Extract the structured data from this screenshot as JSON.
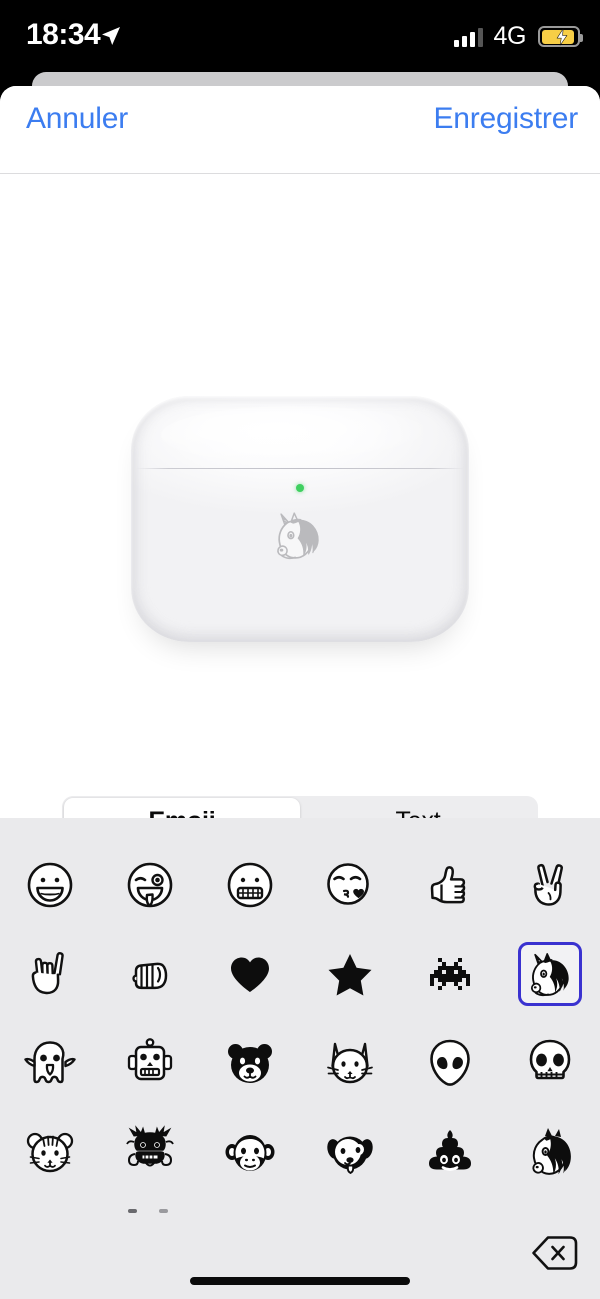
{
  "status_bar": {
    "time": "18:34",
    "location_icon": "location-arrow-icon",
    "signal_icon": "cellular-signal-icon",
    "signal_bars_filled": 3,
    "signal_bars_total": 4,
    "carrier_network": "4G",
    "battery_icon": "battery-charging-icon",
    "battery_color": "#F7CE46",
    "battery_level_percent": 76
  },
  "nav_bar": {
    "cancel_label": "Annuler",
    "save_label": "Enregistrer",
    "accent_color": "#3C7DF0"
  },
  "preview": {
    "device_name": "airpods-pro-case",
    "led_color": "#3FD060",
    "engraving_emoji": "unicorn",
    "engraving_glyph": "🦄"
  },
  "segmented_control": {
    "selected_index": 0,
    "options": [
      {
        "label": "Emoji",
        "selected": true
      },
      {
        "label": "Text",
        "selected": false
      }
    ]
  },
  "emoji_keyboard": {
    "background_color": "#EAEAEC",
    "selection_color": "#3A32D0",
    "selected_emoji": "unicorn",
    "delete_key_icon": "backspace-delete-icon",
    "page_count": 2,
    "current_page": 1,
    "rows": [
      [
        {
          "name": "grinning-face",
          "glyph": "😀"
        },
        {
          "name": "winking-face-with-tongue",
          "glyph": "😜"
        },
        {
          "name": "grimacing-face",
          "glyph": "😬"
        },
        {
          "name": "face-blowing-a-kiss",
          "glyph": "😘"
        },
        {
          "name": "thumbs-up",
          "glyph": "👍"
        },
        {
          "name": "victory-hand",
          "glyph": "✌"
        }
      ],
      [
        {
          "name": "love-you-gesture",
          "glyph": "🤟"
        },
        {
          "name": "oncoming-fist",
          "glyph": "👊"
        },
        {
          "name": "black-heart",
          "glyph": "🖤"
        },
        {
          "name": "star",
          "glyph": "★"
        },
        {
          "name": "alien-monster",
          "glyph": "👾"
        },
        {
          "name": "unicorn",
          "glyph": "🦄",
          "selected": true
        }
      ],
      [
        {
          "name": "ghost",
          "glyph": "👻"
        },
        {
          "name": "robot",
          "glyph": "🤖"
        },
        {
          "name": "bear-face",
          "glyph": "🐻"
        },
        {
          "name": "cat-face",
          "glyph": "🐱"
        },
        {
          "name": "alien",
          "glyph": "👽"
        },
        {
          "name": "skull",
          "glyph": "💀"
        }
      ],
      [
        {
          "name": "tiger-face",
          "glyph": "🐯"
        },
        {
          "name": "dragon-face",
          "glyph": "🐲"
        },
        {
          "name": "monkey-face",
          "glyph": "🐵"
        },
        {
          "name": "dog-face",
          "glyph": "🐶"
        },
        {
          "name": "pile-of-poo",
          "glyph": "💩"
        },
        {
          "name": "horse-face",
          "glyph": "🐴"
        }
      ]
    ]
  }
}
